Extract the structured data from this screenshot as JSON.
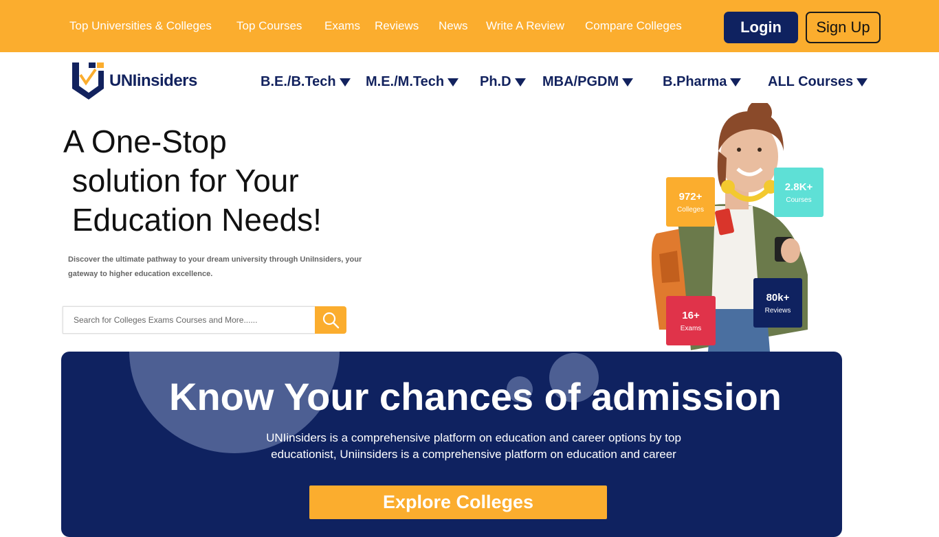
{
  "topnav": {
    "items": [
      "Top Universities & Colleges",
      "Top Courses",
      "Exams",
      "Reviews",
      "News",
      "Write A Review",
      "Compare Colleges"
    ],
    "login": "Login",
    "signup": "Sign Up"
  },
  "logo": {
    "text": "UNIinsiders"
  },
  "course_nav": {
    "items": [
      "B.E./B.Tech",
      "M.E./M.Tech",
      "Ph.D",
      "MBA/PGDM",
      "B.Pharma",
      "ALL Courses"
    ]
  },
  "hero": {
    "title": "A One-Stop\n solution for Your\n Education Needs!",
    "subtitle": "Discover the ultimate pathway to your dream university through UniInsiders, your gateway to higher education excellence.",
    "search_placeholder": "Search for Colleges Exams Courses and More......"
  },
  "stats": [
    {
      "value": "972+",
      "label": "Colleges",
      "color": "#fbad2e"
    },
    {
      "value": "2.8K+",
      "label": "Courses",
      "color": "#5ee0d6"
    },
    {
      "value": "16+",
      "label": "Exams",
      "color": "#e0334a"
    },
    {
      "value": "80k+",
      "label": "Reviews",
      "color": "#0f2260"
    }
  ],
  "banner": {
    "title": "Know Your chances of admission",
    "text": "UNIinsiders is a comprehensive platform on education and career options by top educationist, Uniinsiders is a comprehensive platform on education and career",
    "button": "Explore Colleges"
  },
  "colors": {
    "accent": "#fbad2e",
    "navy": "#0f2260"
  }
}
